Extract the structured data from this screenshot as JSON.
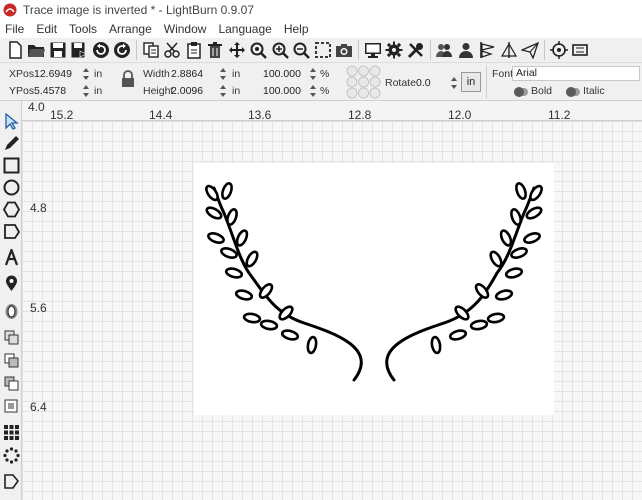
{
  "window": {
    "title": "Trace image is inverted * - LightBurn 0.9.07"
  },
  "menu": {
    "items": [
      "File",
      "Edit",
      "Tools",
      "Arrange",
      "Window",
      "Language",
      "Help"
    ]
  },
  "toolbar": {
    "icons": [
      "new-file-icon",
      "open-folder-icon",
      "save-icon",
      "save-as-icon",
      "undo-icon",
      "redo-icon",
      "sep",
      "copy-icon",
      "cut-icon",
      "paste-icon",
      "delete-icon",
      "move-icon",
      "zoom-fit-icon",
      "zoom-in-icon",
      "zoom-out-icon",
      "zoom-selection-icon",
      "camera-icon",
      "sep",
      "monitor-icon",
      "settings-gear-icon",
      "tools-wrench-icon",
      "sep",
      "users-group-icon",
      "user-icon",
      "align-left-icon",
      "align-center-icon",
      "send-icon",
      "sep",
      "target-icon",
      "frame-icon"
    ]
  },
  "props": {
    "xpos_label": "XPos",
    "xpos": "12.6949",
    "xpos_unit": "in",
    "ypos_label": "YPos",
    "ypos": "5.4578",
    "ypos_unit": "in",
    "width_label": "Width",
    "width": "2.8864",
    "width_unit": "in",
    "height_label": "Height",
    "height": "2.0096",
    "height_unit": "in",
    "scale_w": "100.000",
    "scale_w_unit": "%",
    "scale_h": "100.000",
    "scale_h_unit": "%",
    "rotate_label": "Rotate",
    "rotate": "0.0",
    "units_button": "in",
    "font_label": "Font",
    "font_value": "Arial",
    "bold_label": "Bold",
    "italic_label": "Italic"
  },
  "hruler": {
    "ticks": [
      "15.2",
      "14.4",
      "13.6",
      "12.8",
      "12.0",
      "11.2"
    ]
  },
  "vruler": {
    "corner": "4.0",
    "ticks": [
      "4.8",
      "5.6",
      "6.4"
    ]
  },
  "lefttools": {
    "icons": [
      "select-arrow-icon",
      "pencil-icon",
      "rectangle-icon",
      "ellipse-icon",
      "polygon-icon",
      "pentagon-icon",
      "text-icon",
      "position-pin-icon",
      "offset-icon",
      "weld-icon",
      "union-icon",
      "subtract-icon",
      "intersect-icon",
      "grid-array-icon",
      "circular-array-icon",
      "tab-icon"
    ]
  },
  "colors": {
    "accent": "#c62828",
    "canvas_grid": "#e3e3e3"
  }
}
